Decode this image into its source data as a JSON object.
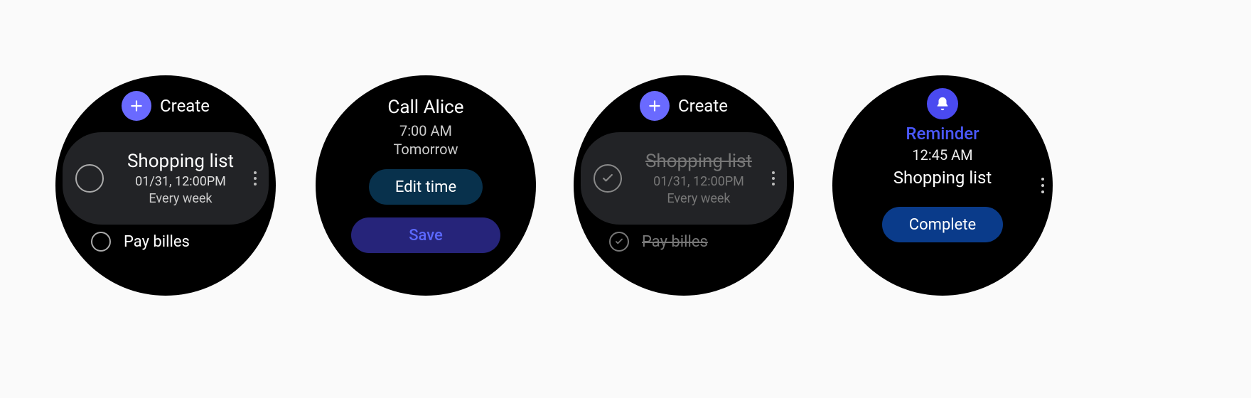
{
  "screens": {
    "list": {
      "create_label": "Create",
      "card": {
        "title": "Shopping list",
        "datetime": "01/31, 12:00PM",
        "recurrence": "Every week"
      },
      "next_item": "Pay billes"
    },
    "edit": {
      "title": "Call Alice",
      "time": "7:00 AM",
      "day": "Tomorrow",
      "edit_time_label": "Edit time",
      "save_label": "Save"
    },
    "list_completed": {
      "create_label": "Create",
      "card": {
        "title": "Shopping list",
        "datetime": "01/31, 12:00PM",
        "recurrence": "Every week"
      },
      "next_item": "Pay billes"
    },
    "notification": {
      "app_name": "Reminder",
      "time": "12:45 AM",
      "title": "Shopping list",
      "complete_label": "Complete"
    }
  }
}
